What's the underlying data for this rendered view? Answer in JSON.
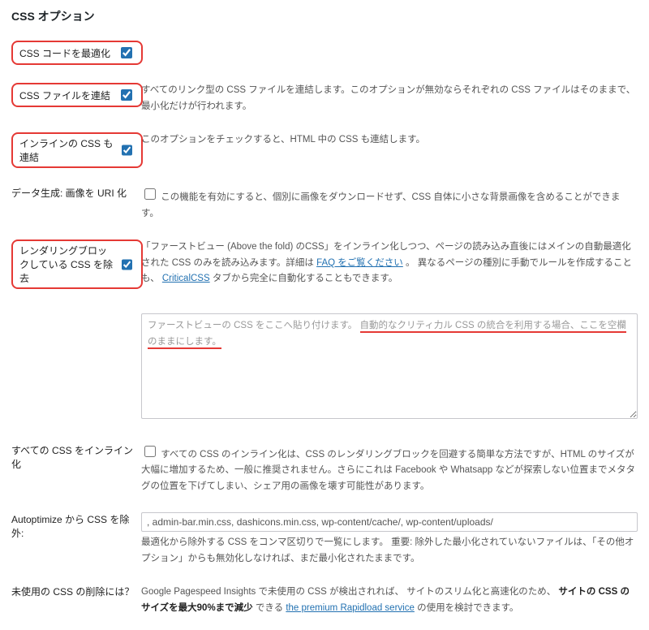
{
  "section_title": "CSS オプション",
  "rows": {
    "optimize_css": {
      "label": "CSS コードを最適化",
      "checked": true
    },
    "concat_files": {
      "label": "CSS ファイルを連結",
      "checked": true,
      "desc": "すべてのリンク型の CSS ファイルを連結します。このオプションが無効ならそれぞれの CSS ファイルはそのままで、最小化だけが行われます。"
    },
    "inline_concat": {
      "label": "インラインの CSS も連結",
      "checked": true,
      "desc": "このオプションをチェックすると、HTML 中の CSS も連結します。"
    },
    "data_uri": {
      "label": "データ生成: 画像を URI 化",
      "checked": false,
      "desc": "この機能を有効にすると、個別に画像をダウンロードせず、CSS 自体に小さな背景画像を含めることができます。"
    },
    "render_block": {
      "label": "レンダリングブロックしている CSS を除去",
      "checked": true,
      "desc_pre": "「ファーストビュー (Above the fold) のCSS」をインライン化しつつ、ページの読み込み直後にはメインの自動最適化された CSS のみを読み込みます。詳細は ",
      "faq_link": "FAQ をご覧ください",
      "desc_post": "。  異なるページの種別に手動でルールを作成することも、",
      "critical_link": "CriticalCSS",
      "desc_tail": "タブから完全に自動化することもできます。"
    },
    "textarea": {
      "placeholder_plain": "ファーストビューの CSS をここへ貼り付けます。",
      "placeholder_underlined": "自動的なクリティ力ル CSS の統合を利用する場合、ここを空欄のままにします。"
    },
    "all_inline": {
      "label": "すべての CSS をインライン化",
      "checked": false,
      "desc": "すべての CSS のインライン化は、CSS のレンダリングブロックを回避する簡単な方法ですが、HTML のサイズが大幅に増加するため、一般に推奨されません。さらにこれは Facebook や Whatsapp などが探索しない位置までメタタグの位置を下げてしまい、シェア用の画像を壊す可能性があります。"
    },
    "exclude": {
      "label": "Autoptimize から CSS を除外:",
      "value": ", admin-bar.min.css, dashicons.min.css, wp-content/cache/, wp-content/uploads/",
      "desc": "最適化から除外する CSS をコンマ区切りで一覧にします。  重要: 除外した最小化されていないファイルは、「その他オプション」からも無効化しなければ、まだ最小化されたままです。"
    },
    "unused": {
      "label": "未使用の CSS の削除には？",
      "desc_pre": "Google Pagespeed Insights で未使用の CSS が検出されれば、  サイトのスリム化と高速化のため、",
      "bold": "サイトの CSS のサイズを最大90%まで減少",
      "desc_post": "できる ",
      "link": "the premium Rapidload service",
      "desc_tail": " の使用を検討できます。"
    }
  }
}
